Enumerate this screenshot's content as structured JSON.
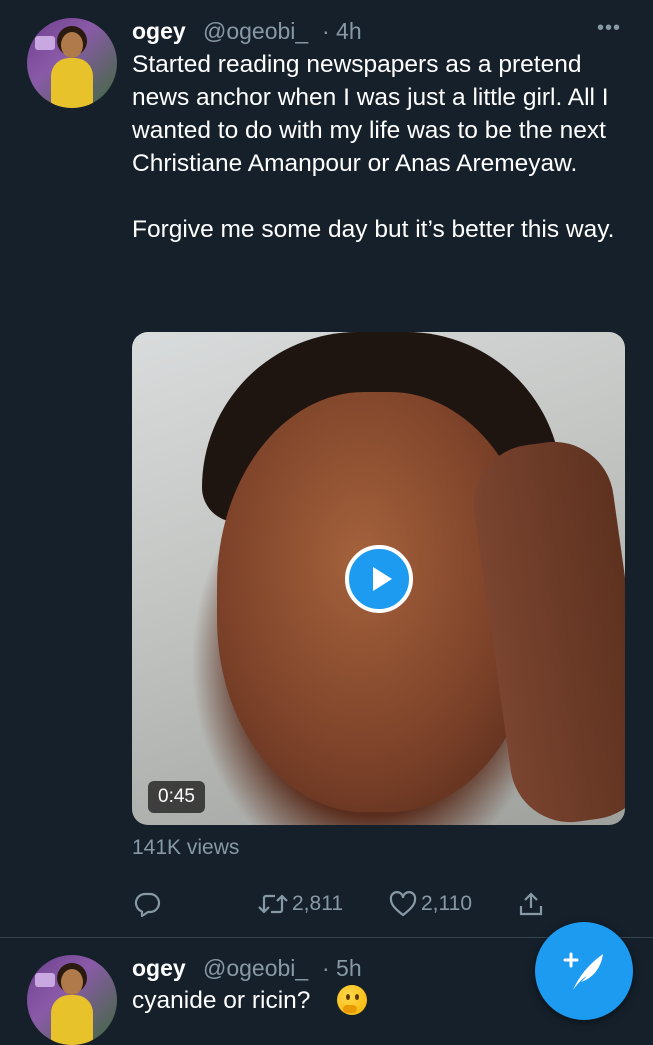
{
  "tweet": {
    "author_name": "ogey",
    "handle": "@ogeobi_",
    "time": "· 4h",
    "more_icon": "more-horizontal-icon",
    "text_paragraphs": [
      "Started reading newspapers as a pretend news anchor when I was just a little girl. All I wanted to do with my life was to be the next Christiane Amanpour or Anas Aremeyaw.",
      "Forgive me some day but it’s better this way."
    ],
    "video": {
      "duration": "0:45",
      "play_icon": "play-icon"
    },
    "views": "141K views",
    "actions": {
      "reply_icon": "reply-icon",
      "retweet_count": "2,811",
      "like_count": "2,110",
      "share_icon": "share-icon"
    }
  },
  "tweet2": {
    "author_name": "ogey",
    "handle": "@ogeobi_",
    "time": "· 5h",
    "text": "cyanide or ricin?",
    "emoji": "thinking-face-emoji"
  },
  "compose_button": {
    "icon": "compose-tweet-icon"
  },
  "colors": {
    "background": "#15202b",
    "text": "#ffffff",
    "secondary": "#8899a6",
    "accent": "#1d9bf0",
    "divider": "#38444d"
  }
}
